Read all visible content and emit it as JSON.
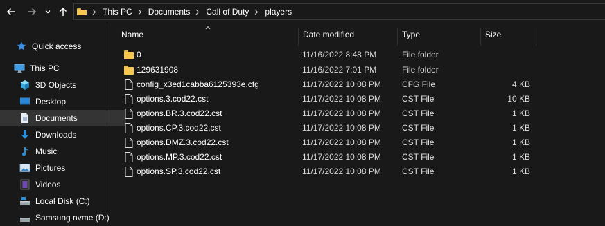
{
  "navigation": {
    "back_icon": "arrow-left-icon",
    "forward_icon": "arrow-right-icon",
    "recent_icon": "chevron-down-icon",
    "up_icon": "arrow-up-icon"
  },
  "address_bar": {
    "breadcrumbs": [
      "This PC",
      "Documents",
      "Call of Duty",
      "players"
    ]
  },
  "sidebar": {
    "items": [
      {
        "label": "Quick access",
        "icon": "star-icon"
      },
      {
        "label": "This PC",
        "icon": "computer-icon"
      },
      {
        "label": "3D Objects",
        "icon": "cube-icon"
      },
      {
        "label": "Desktop",
        "icon": "desktop-icon"
      },
      {
        "label": "Documents",
        "icon": "document-icon",
        "selected": true
      },
      {
        "label": "Downloads",
        "icon": "download-icon"
      },
      {
        "label": "Music",
        "icon": "music-icon"
      },
      {
        "label": "Pictures",
        "icon": "pictures-icon"
      },
      {
        "label": "Videos",
        "icon": "video-icon"
      },
      {
        "label": "Local Disk (C:)",
        "icon": "drive-icon"
      },
      {
        "label": "Samsung nvme (D:)",
        "icon": "drive-icon"
      }
    ]
  },
  "columns": {
    "name": "Name",
    "date_modified": "Date modified",
    "type": "Type",
    "size": "Size"
  },
  "files": [
    {
      "name": "0",
      "date": "11/16/2022 8:48 PM",
      "type": "File folder",
      "size": "",
      "kind": "folder"
    },
    {
      "name": "129631908",
      "date": "11/16/2022 7:01 PM",
      "type": "File folder",
      "size": "",
      "kind": "folder"
    },
    {
      "name": "config_x3ed1cabba6125393e.cfg",
      "date": "11/17/2022 10:08 PM",
      "type": "CFG File",
      "size": "4 KB",
      "kind": "file"
    },
    {
      "name": "options.3.cod22.cst",
      "date": "11/17/2022 10:08 PM",
      "type": "CST File",
      "size": "10 KB",
      "kind": "file"
    },
    {
      "name": "options.BR.3.cod22.cst",
      "date": "11/17/2022 10:08 PM",
      "type": "CST File",
      "size": "1 KB",
      "kind": "file"
    },
    {
      "name": "options.CP.3.cod22.cst",
      "date": "11/17/2022 10:08 PM",
      "type": "CST File",
      "size": "1 KB",
      "kind": "file"
    },
    {
      "name": "options.DMZ.3.cod22.cst",
      "date": "11/17/2022 10:08 PM",
      "type": "CST File",
      "size": "1 KB",
      "kind": "file"
    },
    {
      "name": "options.MP.3.cod22.cst",
      "date": "11/17/2022 10:08 PM",
      "type": "CST File",
      "size": "1 KB",
      "kind": "file"
    },
    {
      "name": "options.SP.3.cod22.cst",
      "date": "11/17/2022 10:08 PM",
      "type": "CST File",
      "size": "1 KB",
      "kind": "file"
    }
  ],
  "colors": {
    "background": "#191919",
    "selected": "#343434",
    "folder": "#f6c84f",
    "accent": "#2d8fd8"
  }
}
